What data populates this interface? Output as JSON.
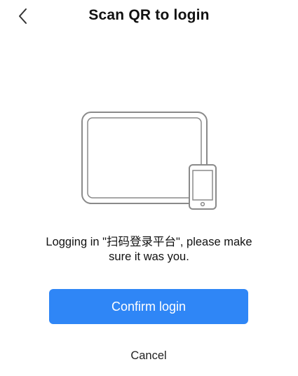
{
  "header": {
    "title": "Scan QR to login",
    "back_icon": "chevron-left-icon"
  },
  "illustration": {
    "icons": [
      "tablet-icon",
      "phone-icon"
    ]
  },
  "message": {
    "line1": "Logging in \"扫码登录平台\", please make",
    "line2": "sure it was you."
  },
  "actions": {
    "confirm_label": "Confirm login",
    "cancel_label": "Cancel"
  },
  "colors": {
    "accent": "#2f86f6",
    "text": "#111111",
    "background": "#ffffff",
    "illustration_stroke": "#8a8a8a"
  }
}
